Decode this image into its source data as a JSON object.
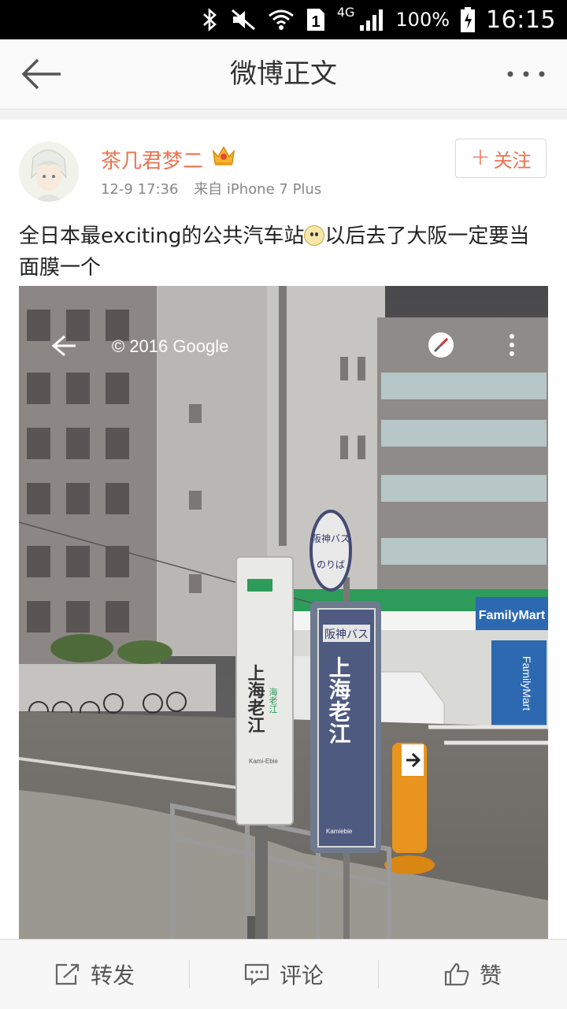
{
  "status_bar": {
    "network": "4G",
    "sim": "1",
    "battery": "100%",
    "time": "16:15"
  },
  "header": {
    "title": "微博正文"
  },
  "post": {
    "username": "茶几君梦二",
    "date": "12-9 17:36",
    "source": "来自 iPhone 7 Plus",
    "follow_label": "关注",
    "text_part1": "全日本最exciting的公共汽车站",
    "text_part2": "以后去了大阪一定要当面膜一个",
    "photo": {
      "watermark": "© 2016 Google",
      "sign_left": "上海老江",
      "sign_left_small": "海老江",
      "sign_left_roman": "Kami-Ebie",
      "sign_round_top": "阪神バス",
      "sign_round_bottom": "のりば",
      "sign_blue_header": "阪神バス",
      "sign_blue_main": "上海老江",
      "sign_blue_roman": "Kamiebie",
      "store_name": "FamilyMart",
      "store_vertical": "FamilyMart"
    }
  },
  "toolbar": {
    "repost": "转发",
    "comment": "评论",
    "like": "赞"
  },
  "colors": {
    "accent": "#eb7350",
    "statusbar": "#000000"
  }
}
